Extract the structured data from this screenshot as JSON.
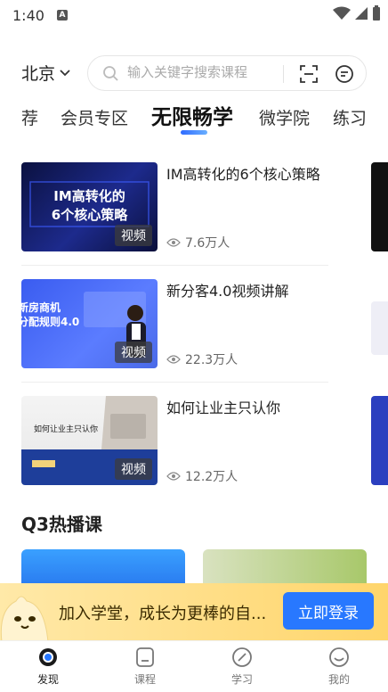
{
  "status_bar": {
    "time": "1:40",
    "notification_icon": "A"
  },
  "header": {
    "city": "北京",
    "search_placeholder": "输入关键字搜索课程"
  },
  "tabs": [
    {
      "label": "荐"
    },
    {
      "label": "会员专区"
    },
    {
      "label": "无限畅学",
      "active": true
    },
    {
      "label": "微学院"
    },
    {
      "label": "练习"
    }
  ],
  "videos": [
    {
      "title": "IM高转化的6个核心策略",
      "thumb_text": "IM高转化的\n6个核心策略",
      "tag": "视频",
      "views": "7.6万人"
    },
    {
      "title": "新分客4.0视频讲解",
      "thumb_text": "新房商机\n分配规则4.0",
      "tag": "视频",
      "views": "22.3万人"
    },
    {
      "title": "如何让业主只认你",
      "thumb_text": "如何让业主只认你",
      "tag": "视频",
      "views": "12.2万人"
    }
  ],
  "section": {
    "title": "Q3热播课"
  },
  "banner": {
    "text": "加入学堂，成长为更棒的自...",
    "button": "立即登录"
  },
  "bottom_nav": [
    {
      "label": "发现",
      "icon": "discover-icon",
      "active": true
    },
    {
      "label": "课程",
      "icon": "course-icon"
    },
    {
      "label": "学习",
      "icon": "study-icon"
    },
    {
      "label": "我的",
      "icon": "profile-icon"
    }
  ],
  "colors": {
    "accent": "#2878ff",
    "banner_bg": "#ffd56b"
  }
}
